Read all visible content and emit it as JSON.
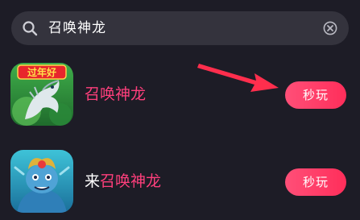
{
  "search": {
    "query": "召唤神龙"
  },
  "results": [
    {
      "title_prefix": "",
      "title_match": "召唤神龙",
      "badge_text": "过年好",
      "play_label": "秒玩"
    },
    {
      "title_prefix": "来",
      "title_match": "召唤神龙",
      "play_label": "秒玩"
    }
  ],
  "colors": {
    "background": "#1d1c26",
    "search_bar": "#34333d",
    "highlight": "#ff3f7c",
    "button": "#ff2e5a",
    "arrow": "#ff2e4d"
  },
  "icons": {
    "search": "search-icon",
    "clear": "clear-icon",
    "annotation": "arrow-icon"
  }
}
